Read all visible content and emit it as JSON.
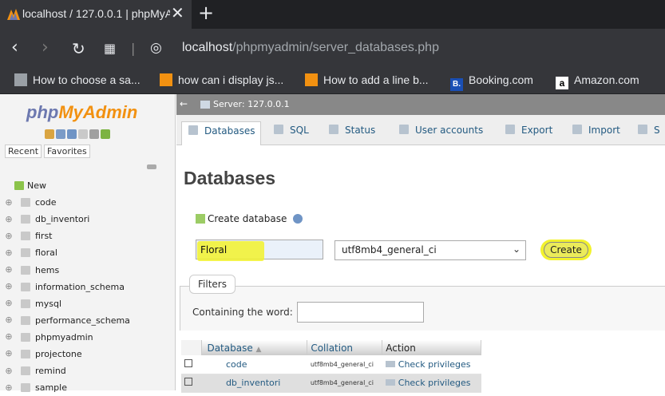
{
  "browser": {
    "tab_title": "localhost / 127.0.0.1 | phpMyA",
    "url_host": "localhost",
    "url_path": "/phpmyadmin/server_databases.php",
    "bookmarks": [
      {
        "label": "How to choose a sa..."
      },
      {
        "label": "how can i display js..."
      },
      {
        "label": "How to add a line b..."
      },
      {
        "label": "Booking.com"
      },
      {
        "label": "Amazon.com"
      }
    ]
  },
  "nav": {
    "logo_php": "php",
    "logo_myadmin": "MyAdmin",
    "tabs": [
      "Recent",
      "Favorites"
    ],
    "new_label": "New",
    "databases": [
      "code",
      "db_inventori",
      "first",
      "floral",
      "hems",
      "information_schema",
      "mysql",
      "performance_schema",
      "phpmyadmin",
      "projectone",
      "remind",
      "sample"
    ]
  },
  "main": {
    "server_label": "Server: 127.0.0.1",
    "tabs": [
      "Databases",
      "SQL",
      "Status",
      "User accounts",
      "Export",
      "Import",
      "S"
    ],
    "title": "Databases",
    "create_label": "Create database",
    "db_name_value": "Floral",
    "collation_value": "utf8mb4_general_ci",
    "create_button": "Create",
    "filters_legend": "Filters",
    "filters_label": "Containing the word:",
    "table": {
      "headers": [
        "Database",
        "Collation",
        "Action"
      ],
      "rows": [
        {
          "name": "code",
          "collation": "utf8mb4_general_ci",
          "action": "Check privileges"
        },
        {
          "name": "db_inventori",
          "collation": "utf8mb4_general_ci",
          "action": "Check privileges"
        }
      ]
    }
  },
  "colors": {
    "highlight": "#f2f22c",
    "link": "#235a81",
    "chrome_dark": "#35363a"
  }
}
